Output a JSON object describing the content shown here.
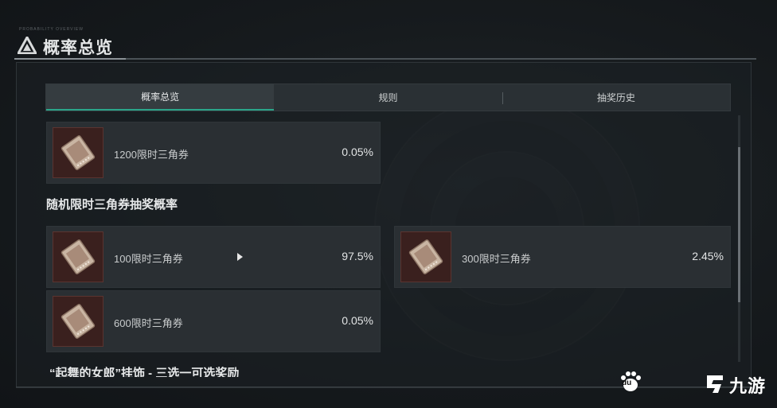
{
  "header": {
    "title": "概率总览",
    "tiny_caption": "PROBABILITY OVERVIEW"
  },
  "tabs": [
    {
      "label": "概率总览",
      "active": true
    },
    {
      "label": "规则",
      "active": false
    },
    {
      "label": "抽奖历史",
      "active": false
    }
  ],
  "top_item": {
    "name": "1200限时三角券",
    "rate": "0.05%",
    "icon": "ticket-icon"
  },
  "random_section": {
    "title": "随机限时三角券抽奖概率",
    "items": [
      {
        "name": "100限时三角券",
        "rate": "97.5%",
        "icon": "ticket-icon"
      },
      {
        "name": "300限时三角券",
        "rate": "2.45%",
        "icon": "ticket-icon"
      },
      {
        "name": "600限时三角券",
        "rate": "0.05%",
        "icon": "ticket-icon"
      }
    ]
  },
  "next_section": {
    "title": "“起舞的女郎”挂饰 - 三选一可选奖励"
  },
  "watermark": {
    "du": "du",
    "brand": "九游"
  },
  "colors": {
    "accent": "#2aa58a",
    "card_bg": "#2a2f33",
    "icon_bg": "#3a201e"
  }
}
